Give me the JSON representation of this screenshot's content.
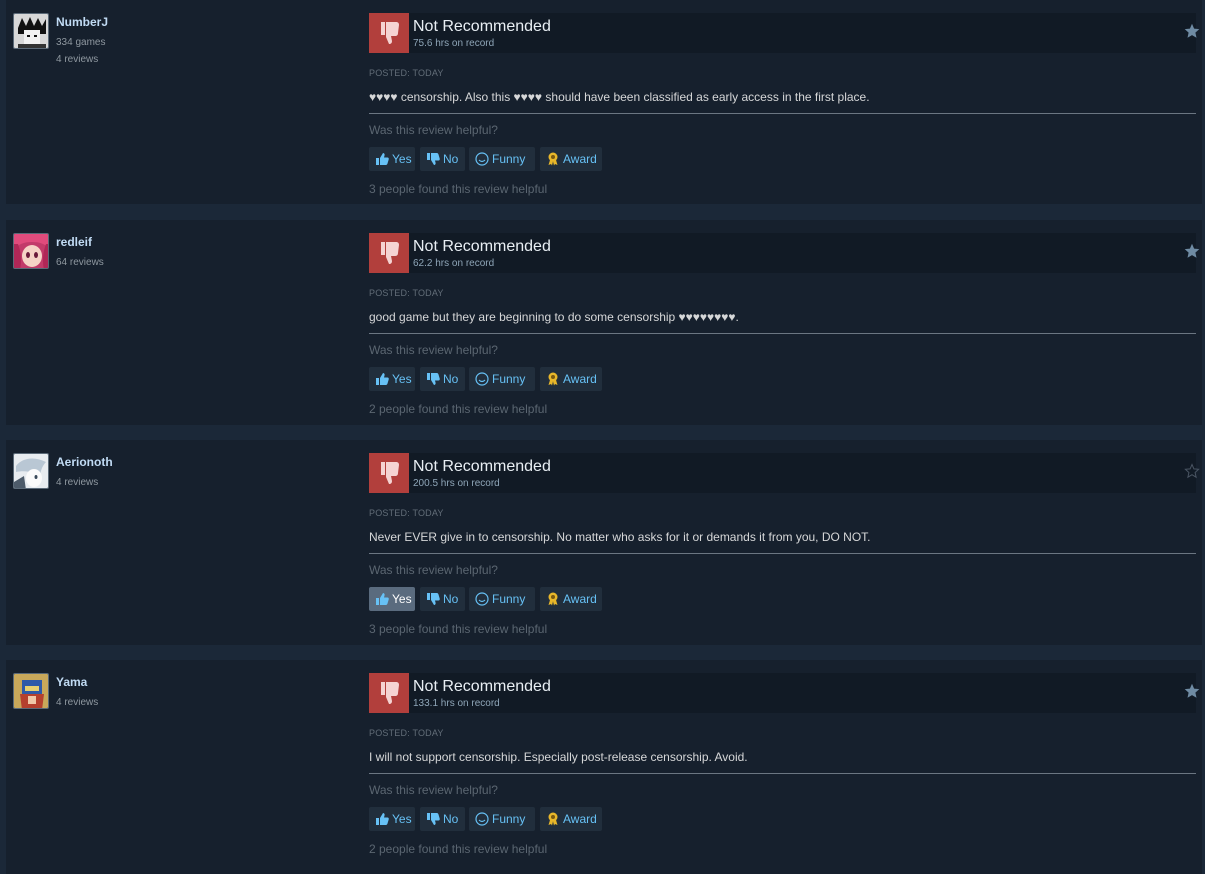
{
  "labels": {
    "vote": "Not Recommended",
    "posted": "POSTED: TODAY",
    "helpful_question": "Was this review helpful?",
    "yes": "Yes",
    "no": "No",
    "funny": "Funny",
    "award": "Award"
  },
  "colors": {
    "not_recommended_bg": "#b23f3c",
    "link_blue": "#67c1f5",
    "author_name": "#c1dbf4"
  },
  "reviews": [
    {
      "author": "NumberJ",
      "games": "334 games",
      "review_count": "4 reviews",
      "hours": "75.6 hrs on record",
      "text": "♥♥♥♥ censorship. Also this ♥♥♥♥ should have been classified as early access in the first place.",
      "found_helpful": "3 people found this review helpful",
      "starred": true,
      "yes_active": false
    },
    {
      "author": "redleif",
      "games": "",
      "review_count": "64 reviews",
      "hours": "62.2 hrs on record",
      "text": "good game but they are beginning to do some censorship ♥♥♥♥♥♥♥♥.",
      "found_helpful": "2 people found this review helpful",
      "starred": true,
      "yes_active": false
    },
    {
      "author": "Aerionoth",
      "games": "",
      "review_count": "4 reviews",
      "hours": "200.5 hrs on record",
      "text": "Never EVER give in to censorship. No matter who asks for it or demands it from you, DO NOT.",
      "found_helpful": "3 people found this review helpful",
      "starred": false,
      "yes_active": true
    },
    {
      "author": "Yama",
      "games": "",
      "review_count": "4 reviews",
      "hours": "133.1 hrs on record",
      "text": "I will not support censorship. Especially post-release censorship. Avoid.",
      "found_helpful": "2 people found this review helpful",
      "starred": true,
      "yes_active": false
    }
  ]
}
